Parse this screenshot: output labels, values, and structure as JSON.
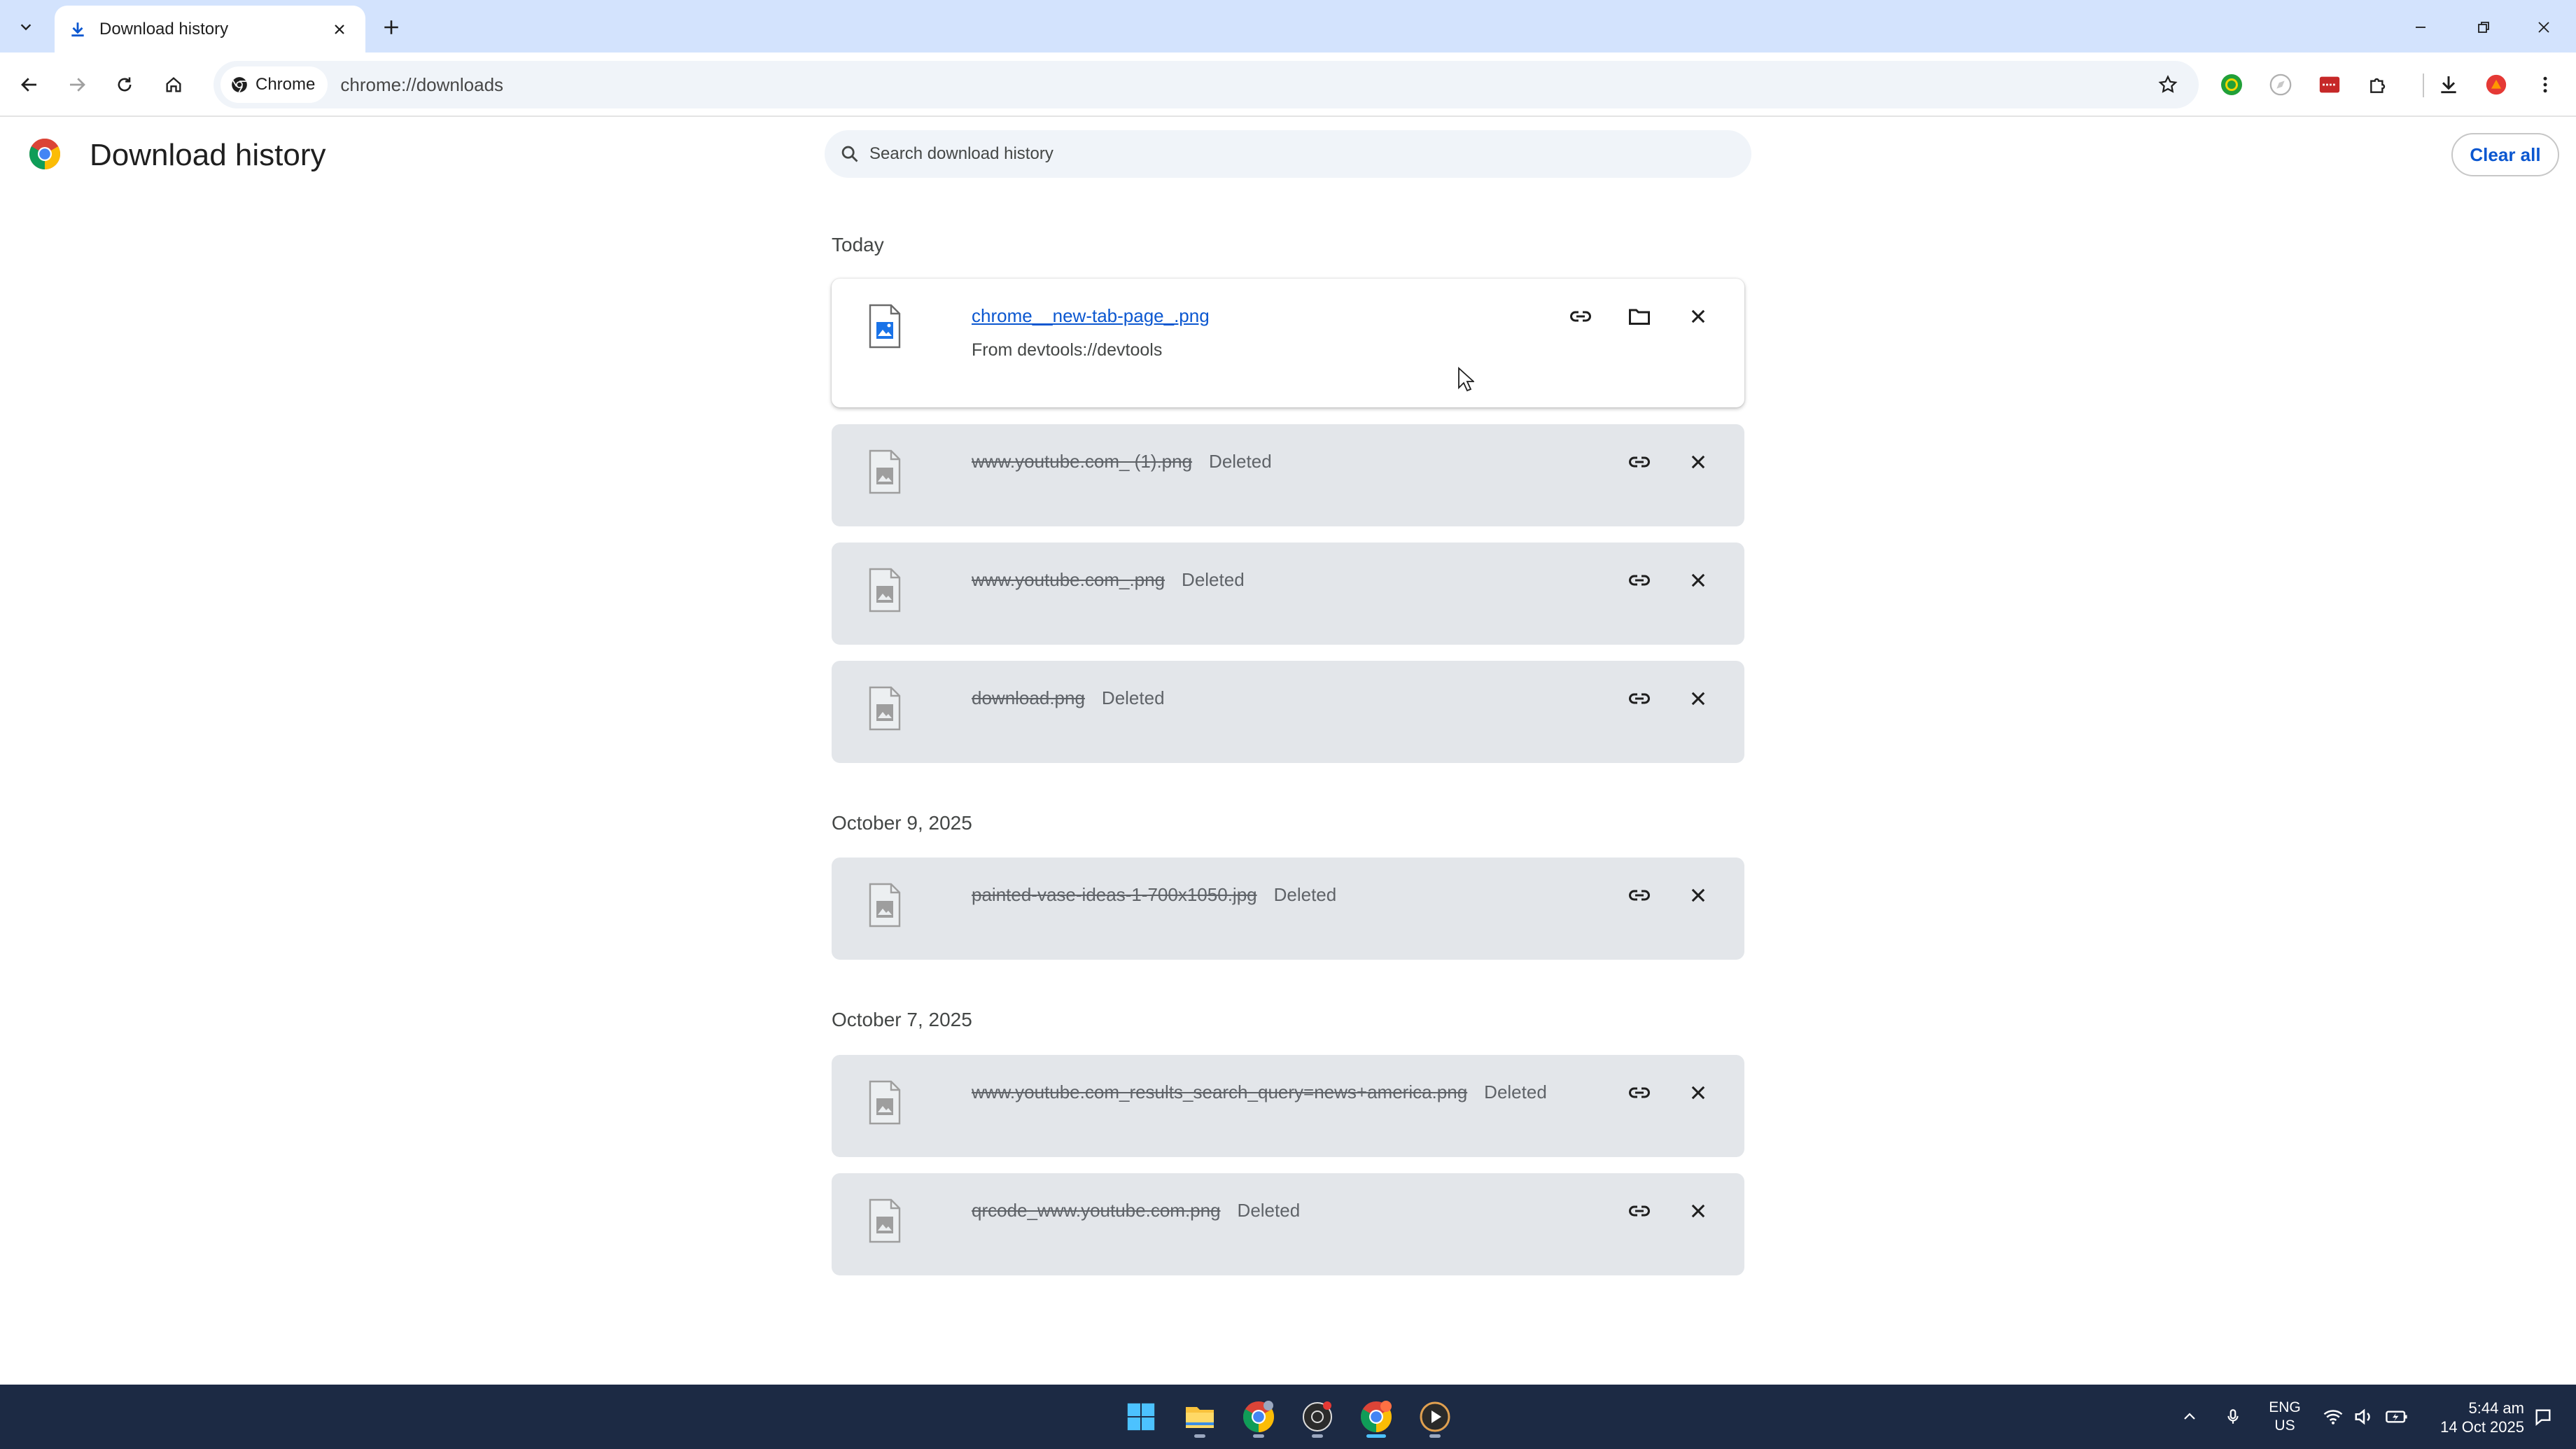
{
  "browser": {
    "tab_title": "Download history",
    "site_chip": "Chrome",
    "url": "chrome://downloads"
  },
  "page": {
    "title": "Download history",
    "search_placeholder": "Search download history",
    "clear_all": "Clear all"
  },
  "groups": [
    {
      "date": "Today",
      "items": [
        {
          "file": "chrome__new-tab-page_.png",
          "source": "From devtools://devtools",
          "status": ""
        },
        {
          "file": "www.youtube.com_ (1).png",
          "status": "Deleted"
        },
        {
          "file": "www.youtube.com_.png",
          "status": "Deleted"
        },
        {
          "file": "download.png",
          "status": "Deleted"
        }
      ]
    },
    {
      "date": "October 9, 2025",
      "items": [
        {
          "file": "painted-vase-ideas-1-700x1050.jpg",
          "status": "Deleted"
        }
      ]
    },
    {
      "date": "October 7, 2025",
      "items": [
        {
          "file": "www.youtube.com_results_search_query=news+america.png",
          "status": "Deleted"
        },
        {
          "file": "qrcode_www.youtube.com.png",
          "status": "Deleted"
        }
      ]
    }
  ],
  "taskbar": {
    "lang_line1": "ENG",
    "lang_line2": "US",
    "time": "5:44 am",
    "date": "14 Oct 2025"
  },
  "colors": {
    "tabstrip": "#d3e3fd",
    "link": "#0b57d0",
    "deleted_card": "#e3e6ea",
    "taskbar": "#1c2a44"
  }
}
